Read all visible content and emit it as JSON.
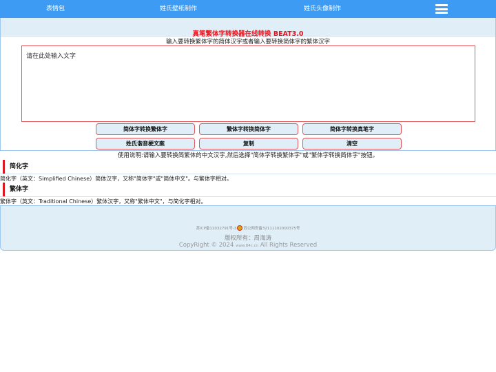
{
  "nav": {
    "links": [
      "表情包",
      "姓氏壁纸制作",
      "姓氏头像制作"
    ],
    "menu_icon": "hamburger-menu-icon"
  },
  "main": {
    "title": "真笔繁体字转换器在线转换 BEAT3.0",
    "subtitle": "输入要转换繁体字的简体汉字或者输入要转换简体字的繁体汉字",
    "input_placeholder": "请在此处输入文字",
    "input_value": "",
    "buttons": [
      "简体字转换繁体字",
      "繁体字转换简体字",
      "简体字转换真笔字",
      "姓氏谐音梗文案",
      "复制",
      "清空"
    ],
    "usage": "使用说明:请输入要转换简繁体的中文汉字,然后选择\"简体字转换繁体字\"或\"繁体字转换简体字\"按钮。"
  },
  "sections": [
    {
      "heading": "简化字",
      "text": "简化字（英文：Simplified Chinese）简体汉字，又称\"简体字\"或\"简体中文\"。与繁体字相对。"
    },
    {
      "heading": "繁体字",
      "text": "繁体字（英文：Traditional Chinese）繁体汉字，又称\"繁体中文\"，与简化字相对。"
    }
  ],
  "footer": {
    "icp": "苏ICP备11032791号-3",
    "police": "苏公网安备32111102000375号",
    "owner": "版权所有：周海涛",
    "copyright": "CopyRight © 2024",
    "site": "www.84c.cn",
    "rights": "All Rights Reserved"
  },
  "colors": {
    "nav_bg": "#3d9bf3",
    "title_red": "#e8141d",
    "panel_bg": "#dfeef7",
    "border_red": "#e0565b",
    "section_accent": "#d9181f"
  }
}
